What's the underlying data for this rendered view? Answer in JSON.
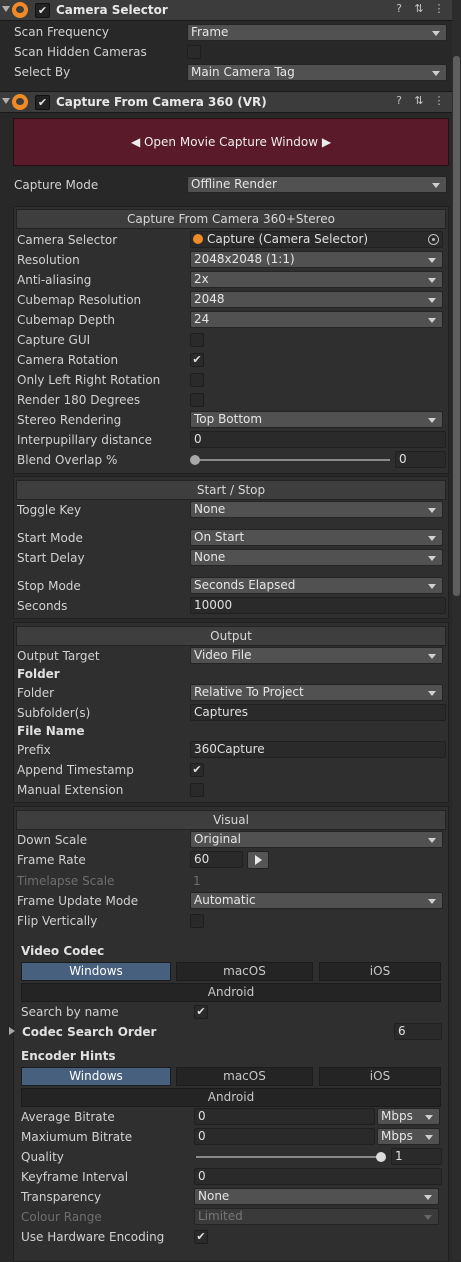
{
  "camera_selector": {
    "title": "Camera Selector",
    "enabled_mark": "✔",
    "scan_frequency_label": "Scan Frequency",
    "scan_frequency_value": "Frame",
    "scan_hidden_label": "Scan Hidden Cameras",
    "select_by_label": "Select By",
    "select_by_value": "Main Camera Tag"
  },
  "capture": {
    "title": "Capture From Camera 360 (VR)",
    "enabled_mark": "✔",
    "open_window_button": "◀ Open Movie Capture Window ▶",
    "capture_mode_label": "Capture Mode",
    "capture_mode_value": "Offline Render"
  },
  "stereo_section": {
    "header": "Capture From Camera 360+Stereo",
    "camera_selector_label": "Camera Selector",
    "camera_selector_value": "Capture (Camera Selector)",
    "resolution_label": "Resolution",
    "resolution_value": "2048x2048 (1:1)",
    "anti_aliasing_label": "Anti-aliasing",
    "anti_aliasing_value": "2x",
    "cubemap_resolution_label": "Cubemap Resolution",
    "cubemap_resolution_value": "2048",
    "cubemap_depth_label": "Cubemap Depth",
    "cubemap_depth_value": "24",
    "capture_gui_label": "Capture GUI",
    "camera_rotation_label": "Camera Rotation",
    "camera_rotation_check": "✔",
    "only_lr_rotation_label": "Only Left Right Rotation",
    "render_180_label": "Render 180 Degrees",
    "stereo_rendering_label": "Stereo Rendering",
    "stereo_rendering_value": "Top Bottom",
    "ipd_label": "Interpupillary distance",
    "ipd_value": "0",
    "blend_overlap_label": "Blend Overlap %",
    "blend_overlap_value": "0"
  },
  "start_stop": {
    "header": "Start / Stop",
    "toggle_key_label": "Toggle Key",
    "toggle_key_value": "None",
    "start_mode_label": "Start Mode",
    "start_mode_value": "On Start",
    "start_delay_label": "Start Delay",
    "start_delay_value": "None",
    "stop_mode_label": "Stop Mode",
    "stop_mode_value": "Seconds Elapsed",
    "seconds_label": "Seconds",
    "seconds_value": "10000"
  },
  "output": {
    "header": "Output",
    "output_target_label": "Output Target",
    "output_target_value": "Video File",
    "folder_heading": "Folder",
    "folder_label": "Folder",
    "folder_value": "Relative To Project",
    "subfolder_label": "Subfolder(s)",
    "subfolder_value": "Captures",
    "file_name_heading": "File Name",
    "prefix_label": "Prefix",
    "prefix_value": "360Capture",
    "append_timestamp_label": "Append Timestamp",
    "append_timestamp_check": "✔",
    "manual_extension_label": "Manual Extension"
  },
  "visual": {
    "header": "Visual",
    "down_scale_label": "Down Scale",
    "down_scale_value": "Original",
    "frame_rate_label": "Frame Rate",
    "frame_rate_value": "60",
    "timelapse_label": "Timelapse Scale",
    "timelapse_value": "1",
    "frame_update_label": "Frame Update Mode",
    "frame_update_value": "Automatic",
    "flip_vertically_label": "Flip Vertically"
  },
  "video_codec": {
    "heading": "Video Codec",
    "tabs": [
      "Windows",
      "macOS",
      "iOS",
      "Android"
    ],
    "search_by_name_label": "Search by name",
    "search_by_name_check": "✔",
    "codec_search_order_label": "Codec Search Order",
    "codec_search_order_value": "6"
  },
  "encoder_hints": {
    "heading": "Encoder Hints",
    "tabs": [
      "Windows",
      "macOS",
      "iOS",
      "Android"
    ],
    "avg_bitrate_label": "Average Bitrate",
    "avg_bitrate_value": "0",
    "avg_bitrate_unit": "Mbps",
    "max_bitrate_label": "Maxiumum Bitrate",
    "max_bitrate_value": "0",
    "max_bitrate_unit": "Mbps",
    "quality_label": "Quality",
    "quality_value": "1",
    "keyframe_label": "Keyframe Interval",
    "keyframe_value": "0",
    "transparency_label": "Transparency",
    "transparency_value": "None",
    "colour_range_label": "Colour Range",
    "colour_range_value": "Limited",
    "hw_encoding_label": "Use Hardware Encoding",
    "hw_encoding_check": "✔"
  },
  "icons": {
    "help": "?",
    "settings": "⇅",
    "menu": "⋮"
  }
}
